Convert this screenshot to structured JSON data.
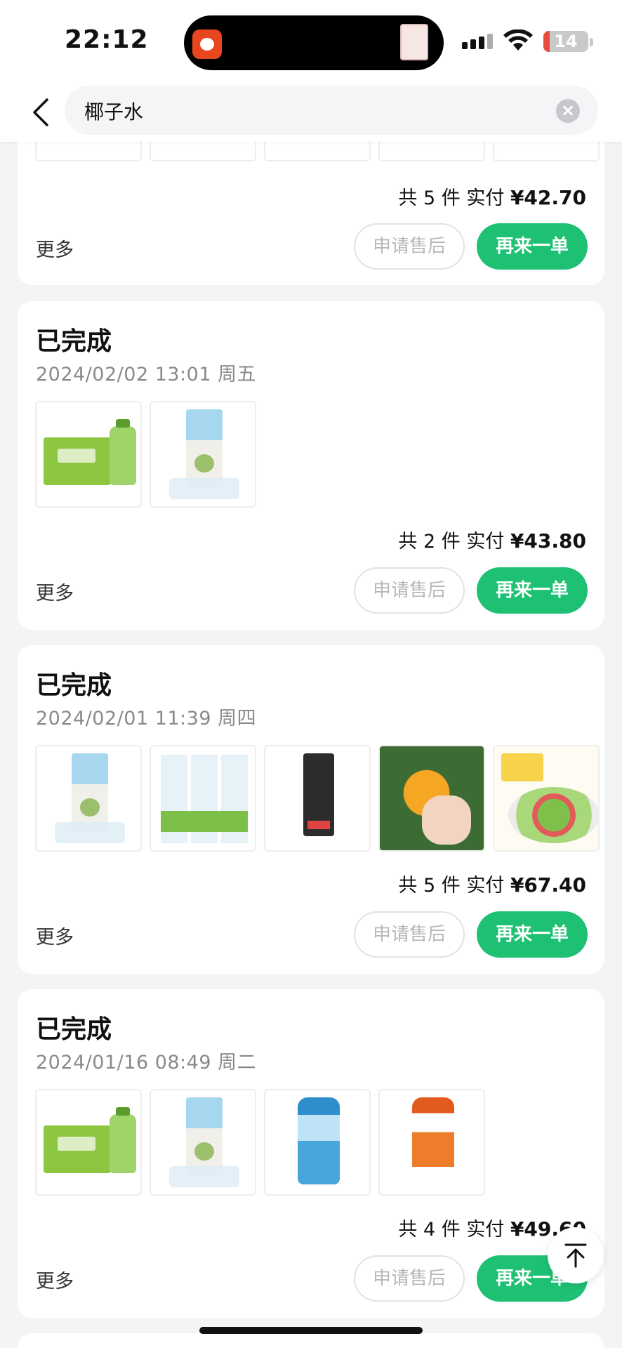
{
  "status_bar": {
    "time": "22:12",
    "battery": "14",
    "battery_level": 0.14
  },
  "search": {
    "query": "椰子水"
  },
  "partial_order": {
    "summary_count": "共 5 件",
    "summary_paid_label": "实付",
    "summary_amount": "¥42.70",
    "more_label": "更多",
    "after_sale_label": "申请售后",
    "reorder_label": "再来一单"
  },
  "orders": [
    {
      "status": "已完成",
      "date": "2024/02/02 13:01 周五",
      "items": [
        "coconut-box-bottle",
        "coconut-carton"
      ],
      "summary_count": "共 2 件",
      "summary_paid_label": "实付",
      "summary_amount": "¥43.80",
      "more_label": "更多",
      "after_sale_label": "申请售后",
      "reorder_label": "再来一单"
    },
    {
      "status": "已完成",
      "date": "2024/02/01 11:39 周四",
      "items": [
        "coconut-carton",
        "coconut-cans",
        "charging-cable",
        "orange",
        "salad"
      ],
      "summary_count": "共 5 件",
      "summary_paid_label": "实付",
      "summary_amount": "¥67.40",
      "more_label": "更多",
      "after_sale_label": "申请售后",
      "reorder_label": "再来一单"
    },
    {
      "status": "已完成",
      "date": "2024/01/16 08:49 周二",
      "items": [
        "coconut-box-bottle",
        "coconut-carton",
        "bleach-blue",
        "bleach-orange"
      ],
      "summary_count": "共 4 件",
      "summary_paid_label": "实付",
      "summary_amount": "¥49.60",
      "more_label": "更多",
      "after_sale_label": "申请售后",
      "reorder_label": "再来一单"
    }
  ],
  "colors": {
    "accent": "#1ec173",
    "background": "#f3f4f6",
    "muted_text": "#8a8a8a"
  },
  "icons": {
    "back": "chevron-left-icon",
    "clear": "clear-icon",
    "scroll_top": "arrow-up-to-top-icon"
  }
}
